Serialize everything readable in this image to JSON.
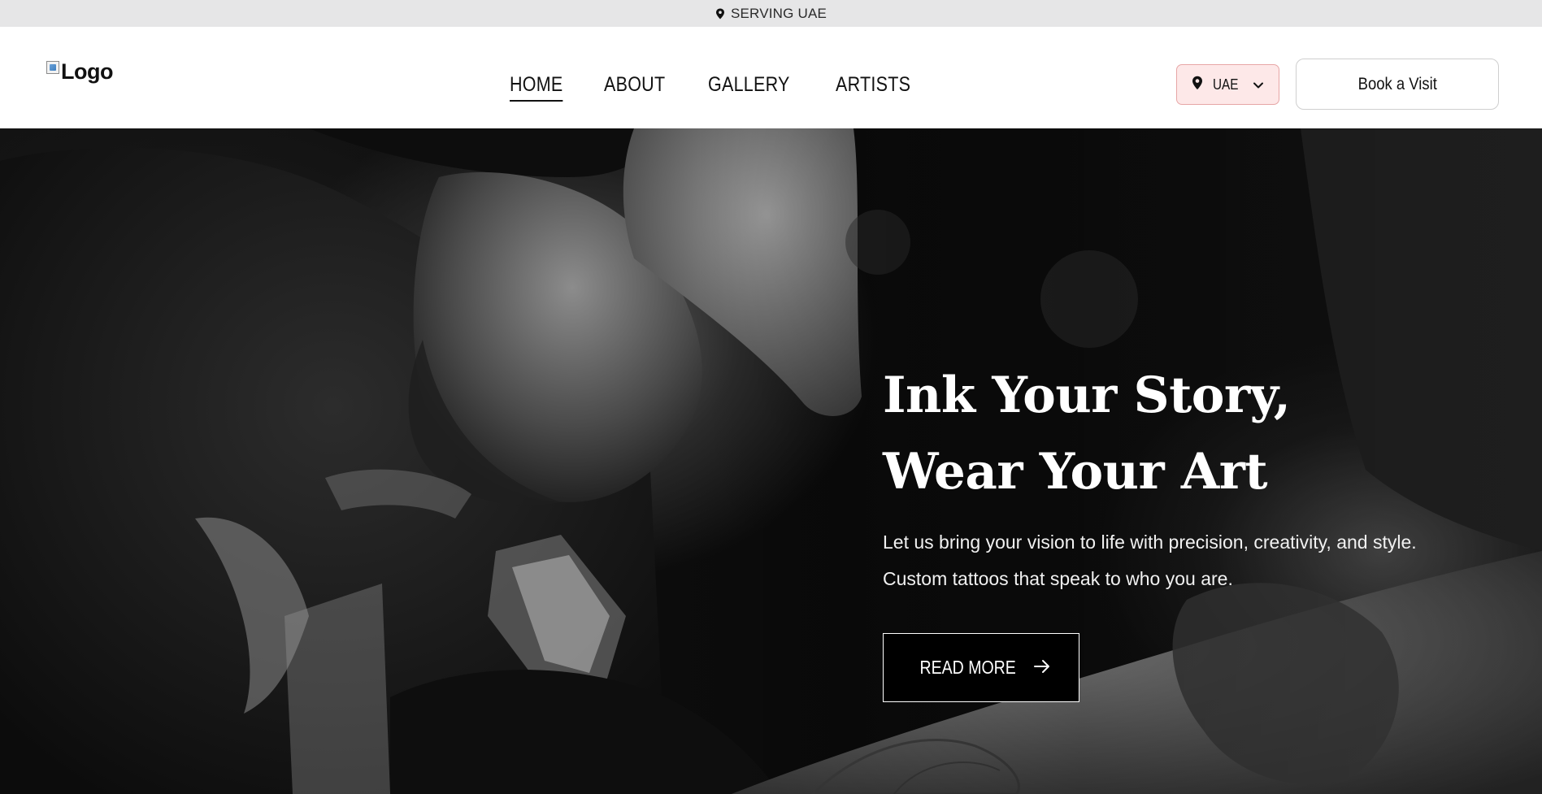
{
  "topbar": {
    "icon": "map-pin-icon",
    "text": "SERVING UAE"
  },
  "header": {
    "logo_alt": "Logo",
    "nav": [
      {
        "label": "HOME",
        "active": true
      },
      {
        "label": "ABOUT",
        "active": false
      },
      {
        "label": "GALLERY",
        "active": false
      },
      {
        "label": "ARTISTS",
        "active": false
      }
    ],
    "region": {
      "icon": "map-pin-icon",
      "value": "UAE",
      "dropdown_icon": "chevron-down-icon"
    },
    "book_label": "Book a Visit"
  },
  "hero": {
    "title_line1": "Ink Your Story,",
    "title_line2": "Wear Your Art",
    "subtitle_line1": "Let us bring your vision to life with precision, creativity, and style.",
    "subtitle_line2": "Custom tattoos that speak to who you are.",
    "cta_label": "READ MORE",
    "cta_icon": "arrow-right-icon"
  },
  "colors": {
    "topbar_bg": "#e6e6e7",
    "region_bg": "#fde8e8",
    "region_border": "#e7a6a6",
    "hero_bg": "#050505",
    "text_dark": "#111111",
    "text_light": "#ffffff"
  }
}
